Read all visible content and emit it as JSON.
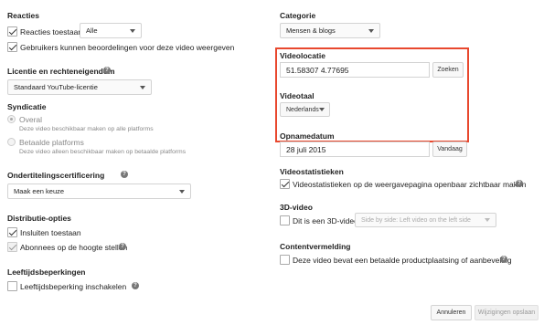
{
  "left": {
    "reacties": {
      "heading": "Reacties",
      "allow_label": "Reacties toestaan",
      "allow_select": "Alle",
      "rating_label": "Gebruikers kunnen beoordelingen voor deze video weergeven"
    },
    "license": {
      "heading": "Licentie en rechteneigendom",
      "value": "Standaard YouTube-licentie"
    },
    "syndication": {
      "heading": "Syndicatie",
      "option1_label": "Overal",
      "option1_sub": "Deze video beschikbaar maken op alle platforms",
      "option2_label": "Betaalde platforms",
      "option2_sub": "Deze video alleen beschikbaar maken op betaalde platforms"
    },
    "subtitles": {
      "heading": "Ondertitelingscertificering",
      "value": "Maak een keuze"
    },
    "distribution": {
      "heading": "Distributie-opties",
      "embed_label": "Insluiten toestaan",
      "notify_label": "Abonnees op de hoogte stellen"
    },
    "age": {
      "heading": "Leeftijdsbeperkingen",
      "label": "Leeftijdsbeperking inschakelen"
    }
  },
  "right": {
    "category": {
      "heading": "Categorie",
      "value": "Mensen & blogs"
    },
    "location": {
      "heading": "Videolocatie",
      "value": "51.58307 4.77695",
      "search_button": "Zoeken"
    },
    "language": {
      "heading": "Videotaal",
      "value": "Nederlands"
    },
    "recording": {
      "heading": "Opnamedatum",
      "value": "28 juli 2015",
      "today_button": "Vandaag"
    },
    "stats": {
      "heading": "Videostatistieken",
      "label": "Videostatistieken op de weergavepagina openbaar zichtbaar maken"
    },
    "three_d": {
      "heading": "3D-video",
      "label": "Dit is een 3D-video",
      "select": "Side by side: Left video on the left side"
    },
    "content": {
      "heading": "Contentvermelding",
      "label": "Deze video bevat een betaalde productplaatsing of aanbeveling"
    }
  },
  "footer": {
    "cancel_button": "Annuleren",
    "save_button": "Wijzigingen opslaan"
  },
  "colors": {
    "highlight_border": "#e8482e"
  },
  "icons": {
    "help": "help-icon",
    "check": "checkmark-icon",
    "caret": "chevron-down-icon"
  },
  "glyphs": {
    "help": "?"
  }
}
